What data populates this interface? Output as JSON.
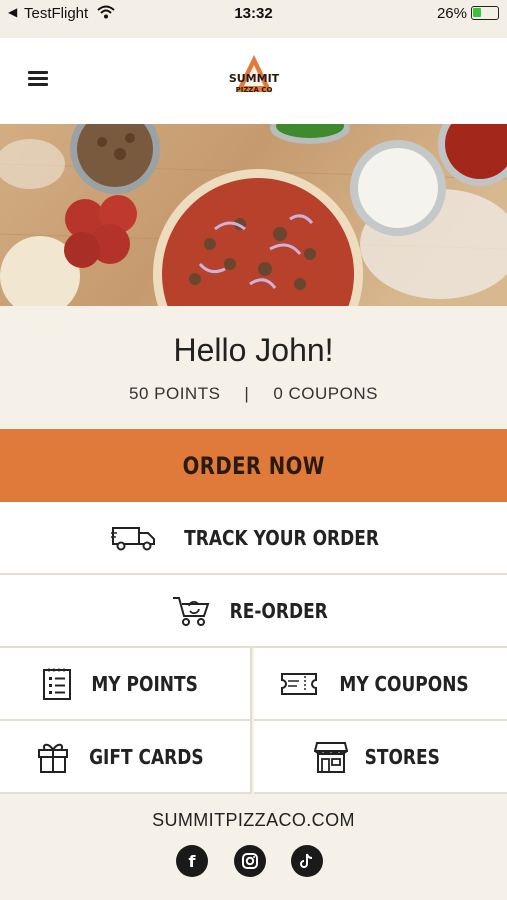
{
  "status_bar": {
    "carrier": "TestFlight",
    "time": "13:32",
    "battery": "26%"
  },
  "nav": {
    "logo_line1": "SUMMIT",
    "logo_line2": "PIZZA CO"
  },
  "greeting": {
    "title": "Hello John!",
    "points": "50 POINTS",
    "separator": "|",
    "coupons": "0 COUPONS"
  },
  "actions": {
    "order_now": "ORDER NOW",
    "track_order": "TRACK YOUR ORDER",
    "reorder": "RE-ORDER",
    "my_points": "MY POINTS",
    "my_coupons": "MY COUPONS",
    "gift_cards": "GIFT CARDS",
    "stores": "STORES"
  },
  "footer": {
    "website": "SUMMITPIZZACO.COM"
  },
  "colors": {
    "accent": "#e07a3a",
    "background": "#f6f1e8"
  }
}
